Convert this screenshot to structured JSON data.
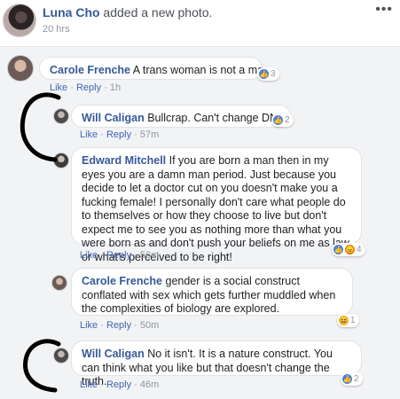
{
  "post": {
    "author": "Luna Cho",
    "action": " added a new photo.",
    "time": "20 hrs",
    "more": "•••"
  },
  "comments": [
    {
      "author": "Carole Frenche",
      "text": " A trans woman is not a man.",
      "like": "Like",
      "reply": "Reply",
      "time": "1h",
      "reaction_count": "3",
      "reactions": [
        "like-icon"
      ]
    },
    {
      "author": "Will Caligan",
      "text": " Bullcrap. Can't change DNA",
      "like": "Like",
      "reply": "Reply",
      "time": "57m",
      "reaction_count": "2",
      "reactions": [
        "like-icon"
      ]
    },
    {
      "author": "Edward Mitchell",
      "text": " If you are born a man then in my eyes you are a damn man period. Just because you decide to let a doctor cut on you doesn't make you a fucking female! I personally don't care what people do to themselves or how they choose to live but don't expect me to see you as nothing more than what you were born as and don't push your beliefs on me as law or what's perceived to be right!",
      "like": "Like",
      "reply": "Reply",
      "time": "56m",
      "reaction_count": "4",
      "reactions": [
        "like-icon",
        "angry-icon"
      ]
    },
    {
      "author": "Carole Frenche",
      "text": " gender is a social construct conflated with sex which gets further muddled when the complexities of biology are explored.",
      "like": "Like",
      "reply": "Reply",
      "time": "50m",
      "reaction_count": "1",
      "reactions": [
        "haha-icon"
      ]
    },
    {
      "author": "Will Caligan",
      "text": " No it isn't. It is a nature construct. You can think what you like but that doesn't change the truth.",
      "like": "Like",
      "reply": "Reply",
      "time": "46m",
      "reaction_count": "2",
      "reactions": [
        "like-icon"
      ]
    }
  ],
  "separator": " · ",
  "colors": {
    "name_link": "#365899",
    "action_link": "#4267b2",
    "meta": "#90949c",
    "panel_bg": "#f2f3f5",
    "scribble": "#000000"
  }
}
